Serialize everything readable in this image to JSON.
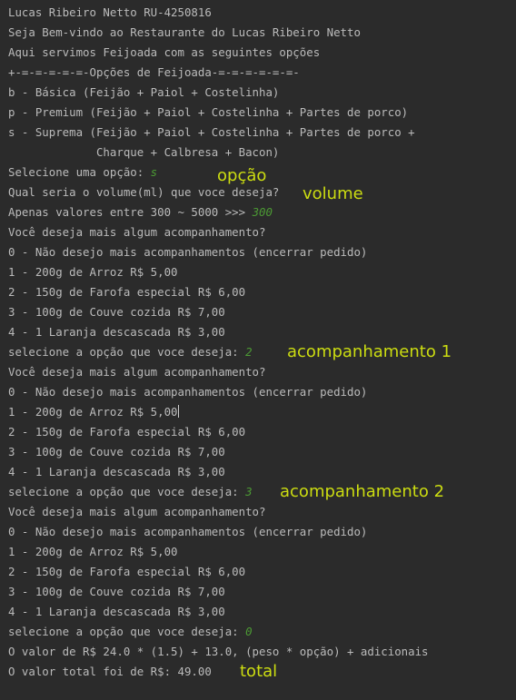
{
  "console": {
    "lines": [
      {
        "text": "Lucas Ribeiro Netto RU-4250816"
      },
      {
        "text": "Seja Bem-vindo ao Restaurante do Lucas Ribeiro Netto"
      },
      {
        "text": "Aqui servimos Feijoada com as seguintes opções"
      },
      {
        "text": "+-=-=-=-=-=-Opções de Feijoada-=-=-=-=-=-=-"
      },
      {
        "text": "b - Básica (Feijão + Paiol + Costelinha)"
      },
      {
        "text": "p - Premium (Feijão + Paiol + Costelinha + Partes de porco)"
      },
      {
        "text": "s - Suprema (Feijão + Paiol + Costelinha + Partes de porco +"
      },
      {
        "text": "             Charque + Calbresa + Bacon)"
      },
      {
        "text": "Selecione uma opção: ",
        "input": "s"
      },
      {
        "text": "Qual seria o volume(ml) que voce deseja?"
      },
      {
        "text": "Apenas valores entre 300 ~ 5000 >>> ",
        "input": "300"
      },
      {
        "text": "Você deseja mais algum acompanhamento?"
      },
      {
        "text": "0 - Não desejo mais acompanhamentos (encerrar pedido)"
      },
      {
        "text": "1 - 200g de Arroz R$ 5,00"
      },
      {
        "text": "2 - 150g de Farofa especial R$ 6,00"
      },
      {
        "text": "3 - 100g de Couve cozida R$ 7,00"
      },
      {
        "text": "4 - 1 Laranja descascada R$ 3,00"
      },
      {
        "text": "selecione a opção que voce deseja: ",
        "input": "2"
      },
      {
        "text": "Você deseja mais algum acompanhamento?"
      },
      {
        "text": "0 - Não desejo mais acompanhamentos (encerrar pedido)"
      },
      {
        "text": "1 - 200g de Arroz R$ 5,00"
      },
      {
        "text": "2 - 150g de Farofa especial R$ 6,00"
      },
      {
        "text": "3 - 100g de Couve cozida R$ 7,00"
      },
      {
        "text": "4 - 1 Laranja descascada R$ 3,00"
      },
      {
        "text": "selecione a opção que voce deseja: ",
        "input": "3"
      },
      {
        "text": "Você deseja mais algum acompanhamento?"
      },
      {
        "text": "0 - Não desejo mais acompanhamentos (encerrar pedido)"
      },
      {
        "text": "1 - 200g de Arroz R$ 5,00"
      },
      {
        "text": "2 - 150g de Farofa especial R$ 6,00"
      },
      {
        "text": "3 - 100g de Couve cozida R$ 7,00"
      },
      {
        "text": "4 - 1 Laranja descascada R$ 3,00"
      },
      {
        "text": "selecione a opção que voce deseja: ",
        "input": "0"
      },
      {
        "text": "O valor de R$ 24.0 * (1.5) + 13.0, (peso * opção) + adicionais"
      },
      {
        "text": "O valor total foi de R$: 49.00"
      }
    ]
  },
  "annotations": {
    "opcao": "opção",
    "volume": "volume",
    "acomp1": "acompanhamento 1",
    "acomp2": "acompanhamento 2",
    "total": "total"
  },
  "colors": {
    "background": "#2b2b2b",
    "text": "#bbbbbb",
    "input": "#4c9b34",
    "annotation": "#ccdd11"
  }
}
